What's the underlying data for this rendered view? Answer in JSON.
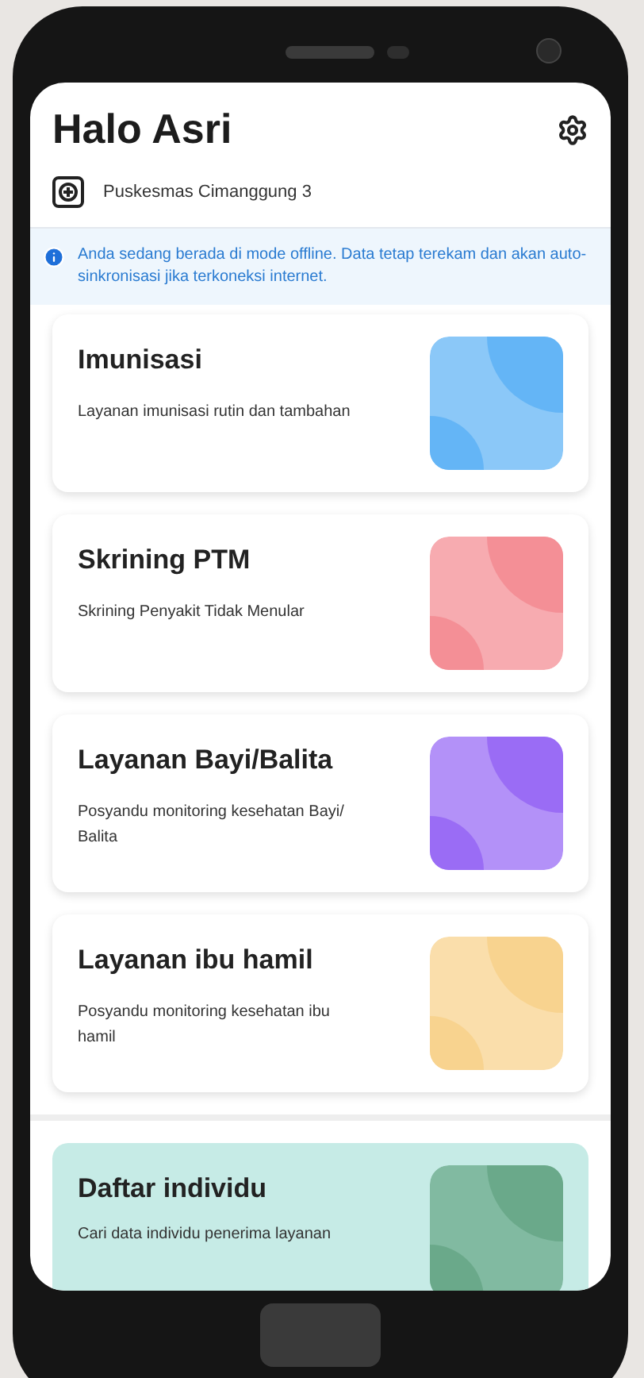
{
  "header": {
    "greeting": "Halo Asri",
    "facility": "Puskesmas Cimanggung 3"
  },
  "offline_notice": "Anda sedang berada di mode offline. Data tetap terekam dan akan auto-sinkronisasi jika terkoneksi internet.",
  "services": [
    {
      "kind": "service",
      "title": "Imunisasi",
      "description": "Layanan imunisasi rutin dan tambahan",
      "color": "#64b5f6"
    },
    {
      "kind": "service",
      "title": "Skrining PTM",
      "description": "Skrining Penyakit Tidak Menular",
      "color": "#f48f96"
    },
    {
      "kind": "service",
      "title": "Layanan Bayi/Balita",
      "description": "Posyandu monitoring kesehatan Bayi/ Balita",
      "color": "#9a6cf5"
    },
    {
      "kind": "service",
      "title": "Layanan ibu hamil",
      "description": "Posyandu monitoring kesehatan ibu hamil",
      "color": "#f8d38f"
    },
    {
      "kind": "highlight",
      "title": "Daftar individu",
      "description": "Cari data individu penerima layanan",
      "color": "#6aa98a"
    }
  ]
}
